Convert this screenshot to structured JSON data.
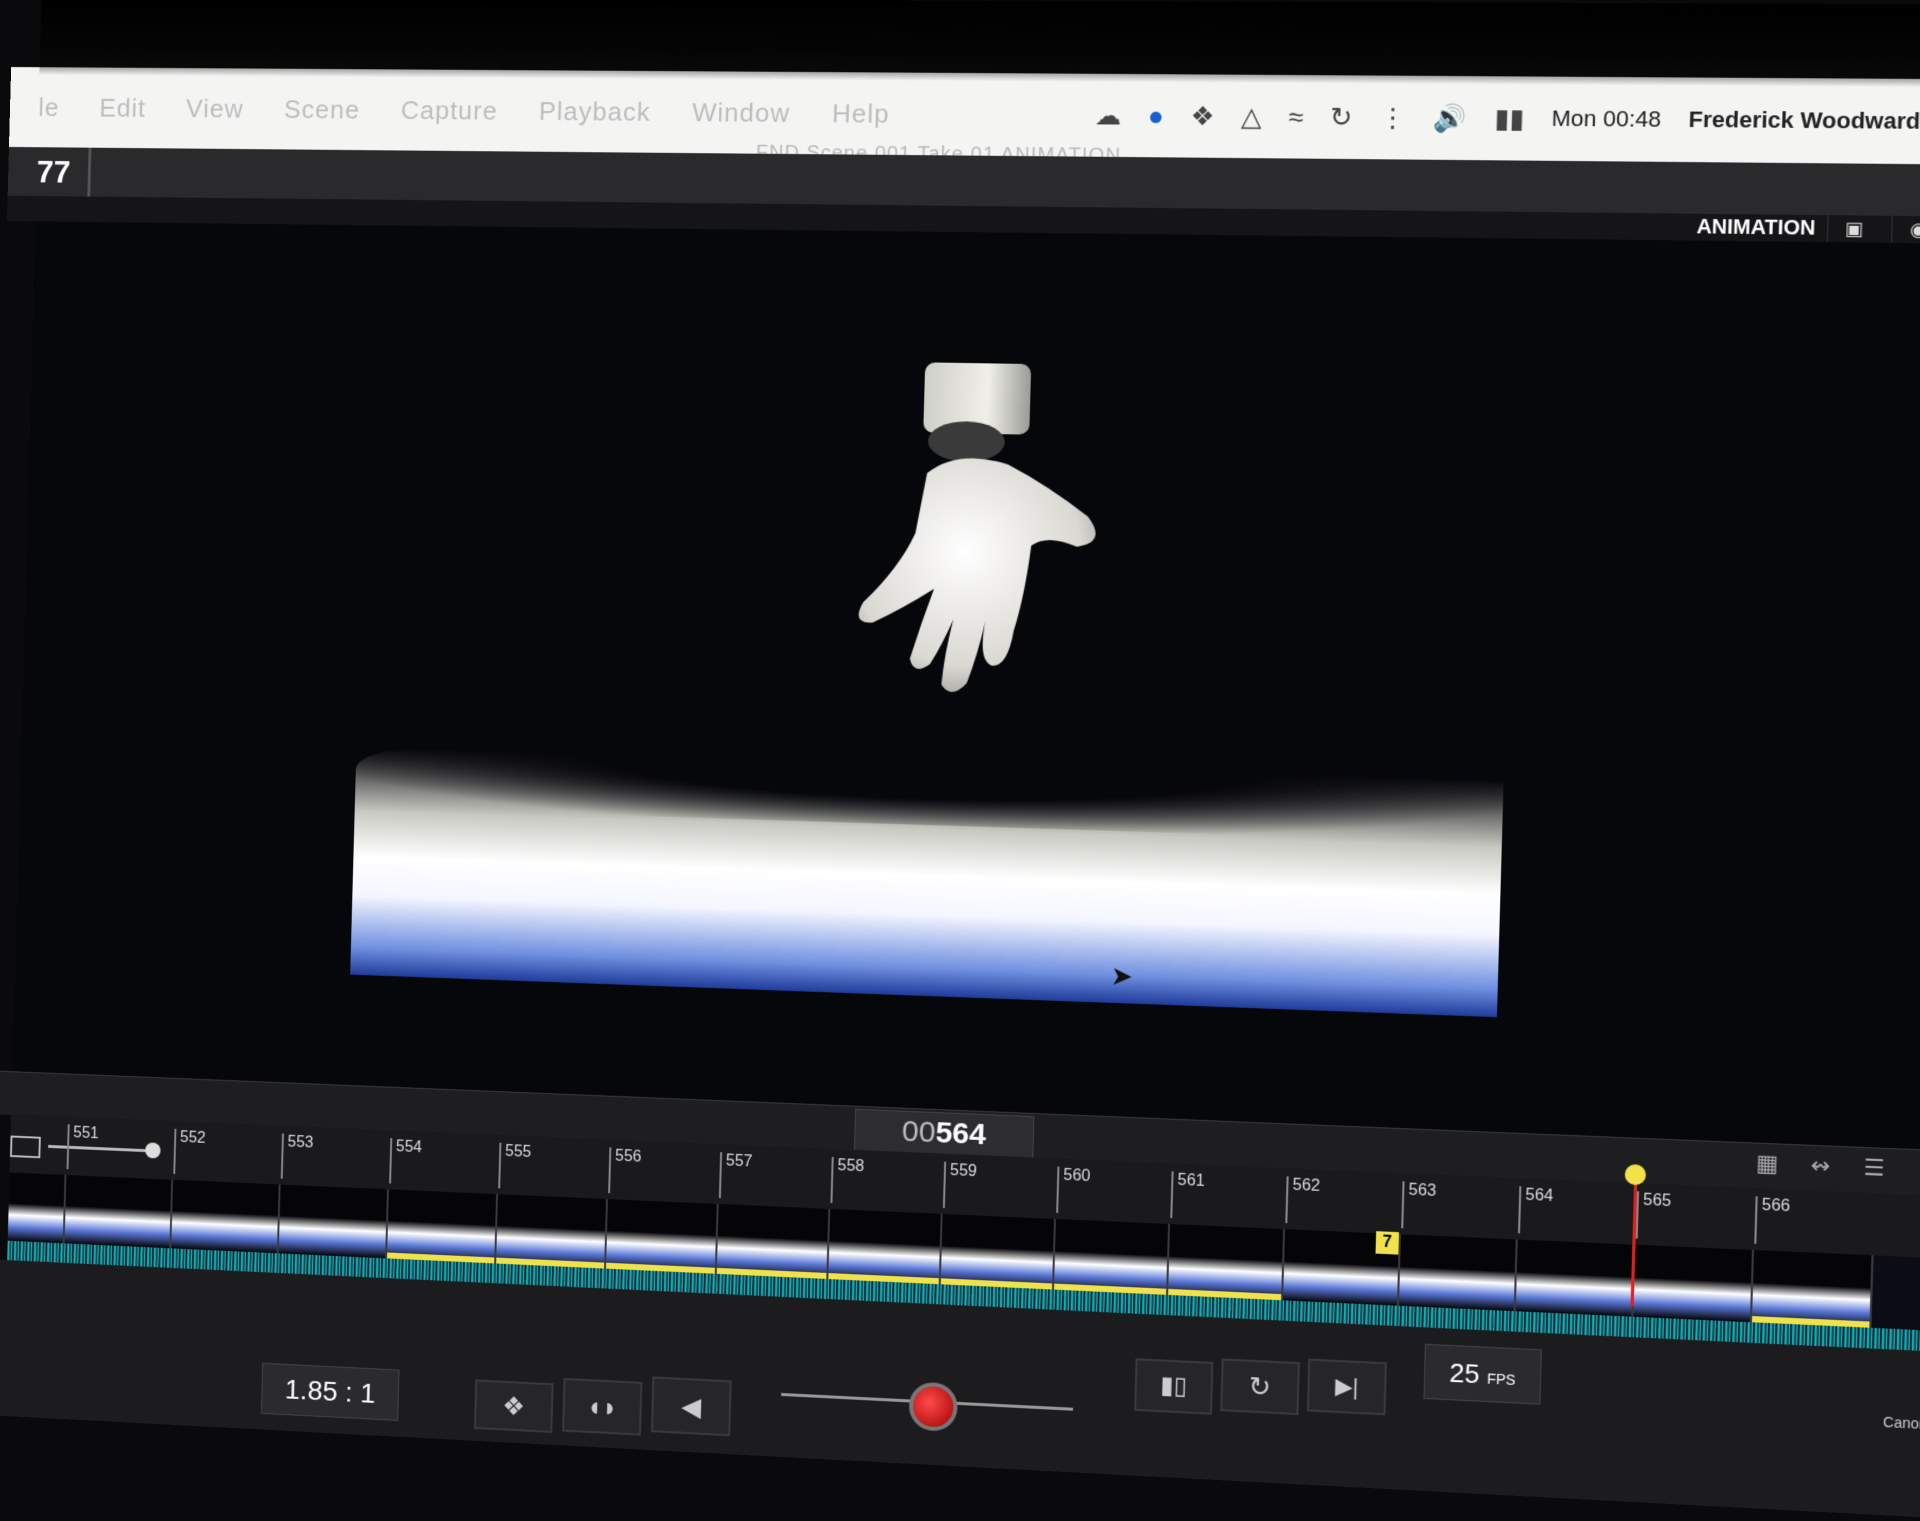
{
  "menubar": {
    "items": [
      "le",
      "Edit",
      "View",
      "Scene",
      "Capture",
      "Playback",
      "Window",
      "Help"
    ],
    "clock": "Mon 00:48",
    "user": "Frederick Woodward",
    "status_icons": [
      "creative-cloud-icon",
      "sync-icon",
      "dropbox-icon",
      "airplay-icon",
      "wifi-icon",
      "time-machine-icon",
      "bluetooth-icon",
      "volume-icon",
      "battery-icon",
      "search-icon"
    ]
  },
  "window": {
    "title": "FND  Scene 001  Take 01   ANIMATION"
  },
  "topbar": {
    "counter": "77"
  },
  "viewbar": {
    "mode": "ANIMATION"
  },
  "timeline": {
    "timecode_prefix": "00",
    "timecode_frame": "564",
    "marker": "7",
    "ticks": [
      "551",
      "552",
      "553",
      "554",
      "555",
      "556",
      "557",
      "558",
      "559",
      "560",
      "561",
      "562",
      "563",
      "564",
      "565",
      "566"
    ]
  },
  "controls": {
    "fps_value": "25",
    "fps_unit": "FPS",
    "aspect_ratio": "1.85 : 1",
    "camera_label": "Canon EOS"
  }
}
